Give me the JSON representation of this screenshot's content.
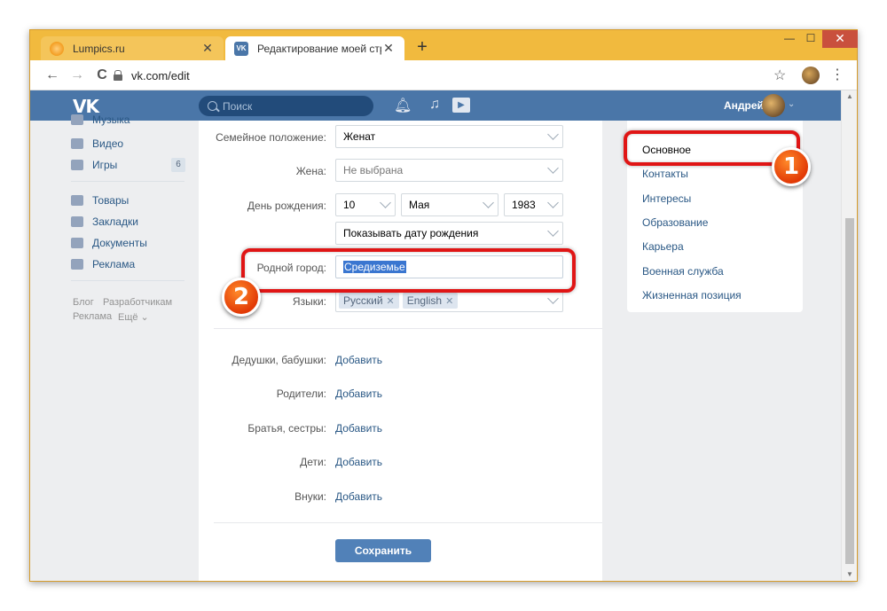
{
  "browser": {
    "tabs": [
      {
        "title": "Lumpics.ru",
        "active": false
      },
      {
        "title": "Редактирование моей страницы",
        "active": true
      }
    ],
    "new_tab_label": "+",
    "close_glyph": "✕",
    "window_controls": {
      "minimize": "—",
      "maximize": "☐",
      "close": "✕"
    },
    "nav": {
      "back": "←",
      "forward": "→",
      "reload": "C"
    },
    "url": "vk.com/edit",
    "star": "☆",
    "menu": "⋮"
  },
  "vk_header": {
    "logo": "VK",
    "search_placeholder": "Поиск",
    "user_name": "Андрей",
    "chevron": "⌄",
    "icons": [
      "bell-icon",
      "music-icon",
      "video-icon"
    ]
  },
  "left_nav": {
    "items": [
      {
        "label": "Музыка"
      },
      {
        "label": "Видео"
      },
      {
        "label": "Игры",
        "badge": "6"
      },
      {
        "label": "Товары"
      },
      {
        "label": "Закладки"
      },
      {
        "label": "Документы"
      },
      {
        "label": "Реклама"
      }
    ],
    "footer": [
      "Блог",
      "Разработчикам",
      "Реклама",
      "Ещё ⌄"
    ]
  },
  "form": {
    "marital_status": {
      "label": "Семейное положение:",
      "value": "Женат"
    },
    "spouse": {
      "label": "Жена:",
      "value": "Не выбрана"
    },
    "birthday": {
      "label": "День рождения:",
      "day": "10",
      "month": "Мая",
      "year": "1983",
      "visibility": "Показывать дату рождения"
    },
    "hometown": {
      "label": "Родной город:",
      "value": "Средиземье"
    },
    "languages": {
      "label": "Языки:",
      "tags": [
        "Русский",
        "English"
      ],
      "remove_glyph": "✕"
    },
    "relatives": [
      {
        "label": "Дедушки, бабушки:",
        "action": "Добавить"
      },
      {
        "label": "Родители:",
        "action": "Добавить"
      },
      {
        "label": "Братья, сестры:",
        "action": "Добавить"
      },
      {
        "label": "Дети:",
        "action": "Добавить"
      },
      {
        "label": "Внуки:",
        "action": "Добавить"
      }
    ],
    "save_label": "Сохранить"
  },
  "right_menu": {
    "items": [
      "Основное",
      "Контакты",
      "Интересы",
      "Образование",
      "Карьера",
      "Военная служба",
      "Жизненная позиция"
    ],
    "active_index": 0
  },
  "annotations": {
    "marker1": "1",
    "marker2": "2",
    "color": "#e01515"
  },
  "colors": {
    "vk_blue": "#4a76a8",
    "link": "#2a5885",
    "button": "#5181b8",
    "browser_frame": "#f1ba3e"
  }
}
